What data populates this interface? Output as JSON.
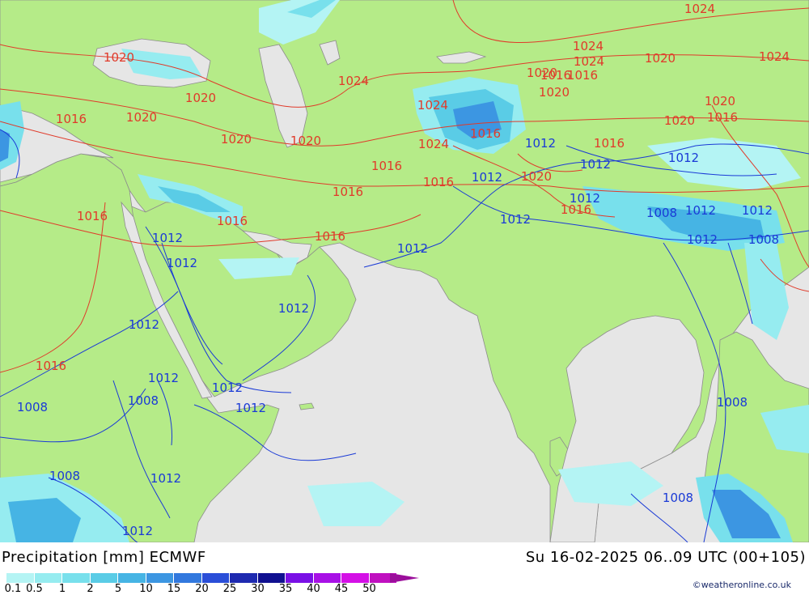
{
  "title": "Precipitation [mm] ECMWF",
  "run_info": "Su 16-02-2025 06..09 UTC (00+105)",
  "credit": "©weatheronline.co.uk",
  "colors": {
    "sea": "#e6e6e6",
    "land": "#b5eb88",
    "high_isobar": "#e03a2a",
    "low_isobar": "#1a3ad6",
    "border": "#8c8c8c"
  },
  "legend": {
    "labels": [
      "0.1",
      "0.5",
      "1",
      "2",
      "5",
      "10",
      "15",
      "20",
      "25",
      "30",
      "35",
      "40",
      "45",
      "50"
    ],
    "colors": [
      "#b4f4f4",
      "#96ecf0",
      "#78e0ec",
      "#5acce6",
      "#46b4e4",
      "#3c96e2",
      "#3278de",
      "#2a4ed8",
      "#1e2ab0",
      "#101090",
      "#7a10e6",
      "#a810e6",
      "#d410e6",
      "#c010c0"
    ]
  },
  "isobar_labels": [
    {
      "text": "1024",
      "type": "hp"
    },
    {
      "text": "1024",
      "type": "hp"
    },
    {
      "text": "1024",
      "type": "hp"
    },
    {
      "text": "1020",
      "type": "hp"
    },
    {
      "text": "1020",
      "type": "hp"
    },
    {
      "text": "1016",
      "type": "hp"
    },
    {
      "text": "1020",
      "type": "hp"
    },
    {
      "text": "1024",
      "type": "hp"
    },
    {
      "text": "1024",
      "type": "hp"
    },
    {
      "text": "1020",
      "type": "hp"
    },
    {
      "text": "1016",
      "type": "hp"
    },
    {
      "text": "1020",
      "type": "hp"
    },
    {
      "text": "1016",
      "type": "hp"
    },
    {
      "text": "1020",
      "type": "hp"
    },
    {
      "text": "1020",
      "type": "hp"
    },
    {
      "text": "1016",
      "type": "hp"
    },
    {
      "text": "1020",
      "type": "hp"
    },
    {
      "text": "1020",
      "type": "hp"
    },
    {
      "text": "1024",
      "type": "hp"
    },
    {
      "text": "1016",
      "type": "hp"
    },
    {
      "text": "1024",
      "type": "hp"
    },
    {
      "text": "1012",
      "type": "lp"
    },
    {
      "text": "1016",
      "type": "hp"
    },
    {
      "text": "1020",
      "type": "hp"
    },
    {
      "text": "1012",
      "type": "lp"
    },
    {
      "text": "1016",
      "type": "hp"
    },
    {
      "text": "1012",
      "type": "lp"
    },
    {
      "text": "1016",
      "type": "hp"
    },
    {
      "text": "1020",
      "type": "hp"
    },
    {
      "text": "1012",
      "type": "lp"
    },
    {
      "text": "1012",
      "type": "lp"
    },
    {
      "text": "1016",
      "type": "hp"
    },
    {
      "text": "1016",
      "type": "hp"
    },
    {
      "text": "1016",
      "type": "hp"
    },
    {
      "text": "1008",
      "type": "lp"
    },
    {
      "text": "1012",
      "type": "lp"
    },
    {
      "text": "1012",
      "type": "lp"
    },
    {
      "text": "1012",
      "type": "lp"
    },
    {
      "text": "1008",
      "type": "lp"
    },
    {
      "text": "1012",
      "type": "lp"
    },
    {
      "text": "1016",
      "type": "hp"
    },
    {
      "text": "1012",
      "type": "lp"
    },
    {
      "text": "1012",
      "type": "lp"
    },
    {
      "text": "1012",
      "type": "lp"
    },
    {
      "text": "1012",
      "type": "lp"
    },
    {
      "text": "1016",
      "type": "hp"
    },
    {
      "text": "1012",
      "type": "lp"
    },
    {
      "text": "1008",
      "type": "lp"
    },
    {
      "text": "1012",
      "type": "lp"
    },
    {
      "text": "1012",
      "type": "lp"
    },
    {
      "text": "1012",
      "type": "lp"
    },
    {
      "text": "1008",
      "type": "lp"
    },
    {
      "text": "1008",
      "type": "lp"
    },
    {
      "text": "1012",
      "type": "lp"
    },
    {
      "text": "1008",
      "type": "lp"
    },
    {
      "text": "1008",
      "type": "lp"
    },
    {
      "text": "1012",
      "type": "lp"
    },
    {
      "text": "1016",
      "type": "hp"
    }
  ]
}
